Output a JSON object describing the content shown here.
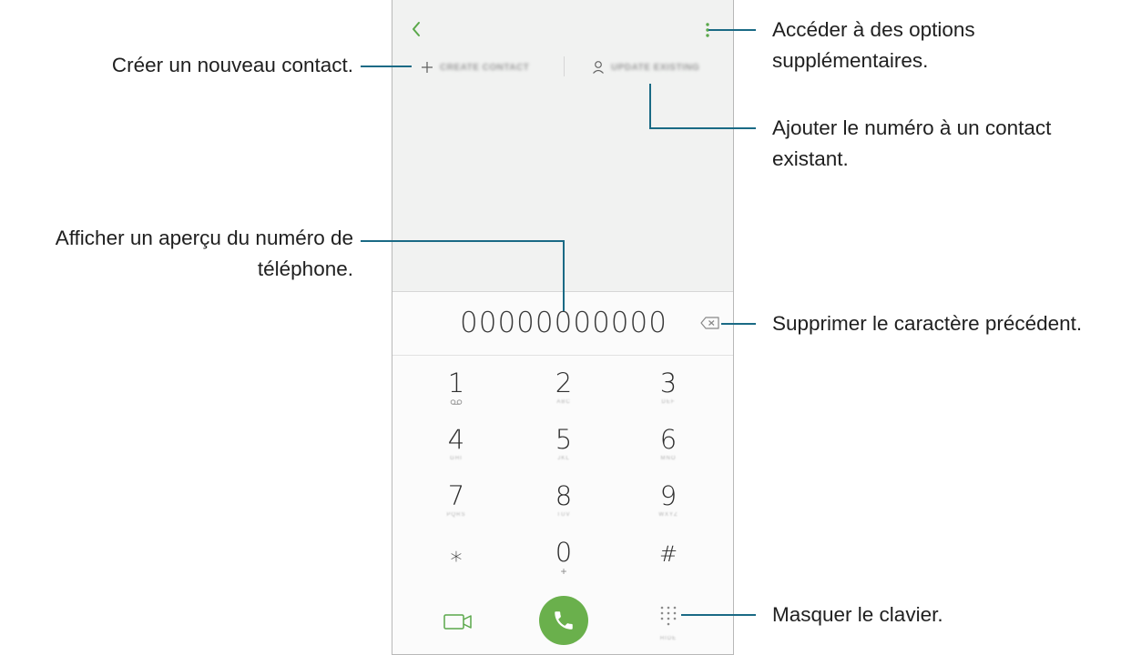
{
  "screen": {
    "phone_number": "00000000000",
    "actions": {
      "create_contact": "CREATE CONTACT",
      "update_existing": "UPDATE EXISTING"
    },
    "keypad": [
      {
        "digit": "1",
        "letters": ""
      },
      {
        "digit": "2",
        "letters": "ABC"
      },
      {
        "digit": "3",
        "letters": "DEF"
      },
      {
        "digit": "4",
        "letters": "GHI"
      },
      {
        "digit": "5",
        "letters": "JKL"
      },
      {
        "digit": "6",
        "letters": "MNO"
      },
      {
        "digit": "7",
        "letters": "PQRS"
      },
      {
        "digit": "8",
        "letters": "TUV"
      },
      {
        "digit": "9",
        "letters": "WXYZ"
      },
      {
        "digit": "⁎",
        "letters": ""
      },
      {
        "digit": "0",
        "letters": "+"
      },
      {
        "digit": "#",
        "letters": ""
      }
    ],
    "hide_keypad_sub": "HIDE",
    "icons": {
      "back": "chevron-left-icon",
      "more": "more-vertical-icon",
      "create": "plus-icon",
      "update": "person-icon",
      "backspace": "backspace-icon",
      "video": "video-call-icon",
      "call": "phone-icon",
      "keypad": "keypad-grid-icon",
      "voicemail": "voicemail-icon"
    },
    "colors": {
      "accent_green": "#6ab04c",
      "callout_line": "#1a6a85"
    }
  },
  "callouts": {
    "create_contact": "Créer un nouveau contact.",
    "more_options": [
      "Accéder à des options",
      "supplémentaires."
    ],
    "add_existing": [
      "Ajouter le numéro à un contact",
      "existant."
    ],
    "preview_number": [
      "Afficher un aperçu du numéro de",
      "téléphone."
    ],
    "delete_char": "Supprimer le caractère précédent.",
    "hide_keypad": "Masquer le clavier."
  }
}
